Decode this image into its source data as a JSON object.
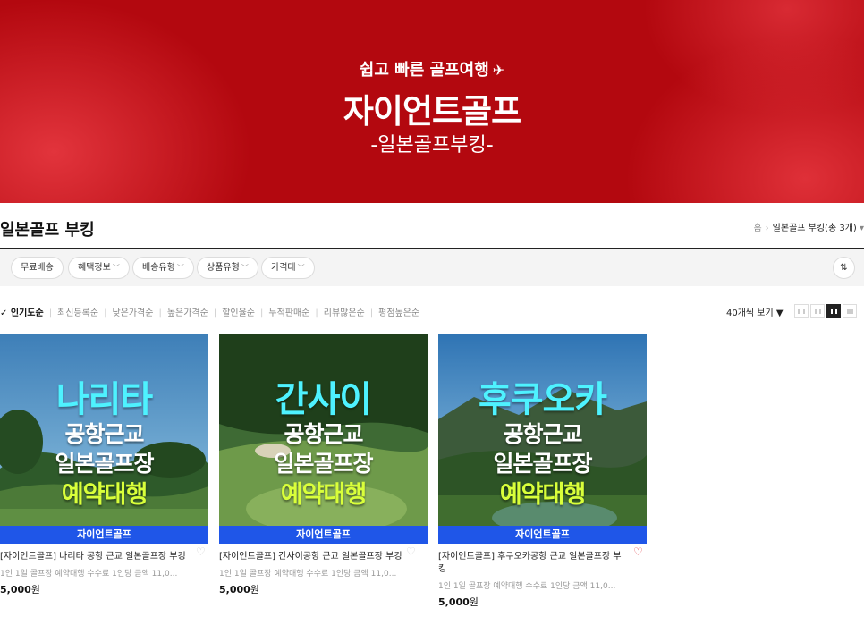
{
  "banner": {
    "subtitle": "쉽고 빠른 골프여행",
    "title": "자이언트골프",
    "tagline": "-일본골프부킹-",
    "color": "#b3080f"
  },
  "header": {
    "title": "일본골프 부킹",
    "breadcrumb": {
      "home": "홈",
      "current": "일본골프 부킹(총 3개)"
    }
  },
  "filters": [
    {
      "label": "무료배송",
      "dropdown": false
    },
    {
      "label": "혜택정보",
      "dropdown": true
    },
    {
      "label": "배송유형",
      "dropdown": true
    },
    {
      "label": "상품유형",
      "dropdown": true
    },
    {
      "label": "가격대",
      "dropdown": true
    }
  ],
  "sort": {
    "items": [
      "인기도순",
      "최신등록순",
      "낮은가격순",
      "높은가격순",
      "할인율순",
      "누적판매순",
      "리뷰많은순",
      "평점높은순"
    ],
    "active_index": 0,
    "per_page": "40개씩 보기"
  },
  "products": [
    {
      "headline": "나리타",
      "line2": "공항근교",
      "line3": "일본골프장",
      "line4": "예약대행",
      "brand": "자이언트골프",
      "name": "[자이언트골프] 나리타 공항 근교 일본골프장 부킹",
      "desc": "1인 1일 골프장 예약대행 수수료 1인당 금액 11,0...",
      "price": "5,000",
      "currency": "원",
      "liked": false
    },
    {
      "headline": "간사이",
      "line2": "공항근교",
      "line3": "일본골프장",
      "line4": "예약대행",
      "brand": "자이언트골프",
      "name": "[자이언트골프] 간사이공항 근교 일본골프장 부킹",
      "desc": "1인 1일 골프장 예약대행 수수료 1인당 금액 11,0...",
      "price": "5,000",
      "currency": "원",
      "liked": false
    },
    {
      "headline": "후쿠오카",
      "line2": "공항근교",
      "line3": "일본골프장",
      "line4": "예약대행",
      "brand": "자이언트골프",
      "name": "[자이언트골프] 후쿠오카공항 근교 일본골프장 부킹",
      "desc": "1인 1일 골프장 예약대행 수수료 1인당 금액 11,0...",
      "price": "5,000",
      "currency": "원",
      "liked": true
    }
  ],
  "colors": {
    "brand_bar": "#1f56e8",
    "headline": "#4ef2ff",
    "highlight": "#d9ff3a",
    "heart_on": "#e0434c"
  }
}
